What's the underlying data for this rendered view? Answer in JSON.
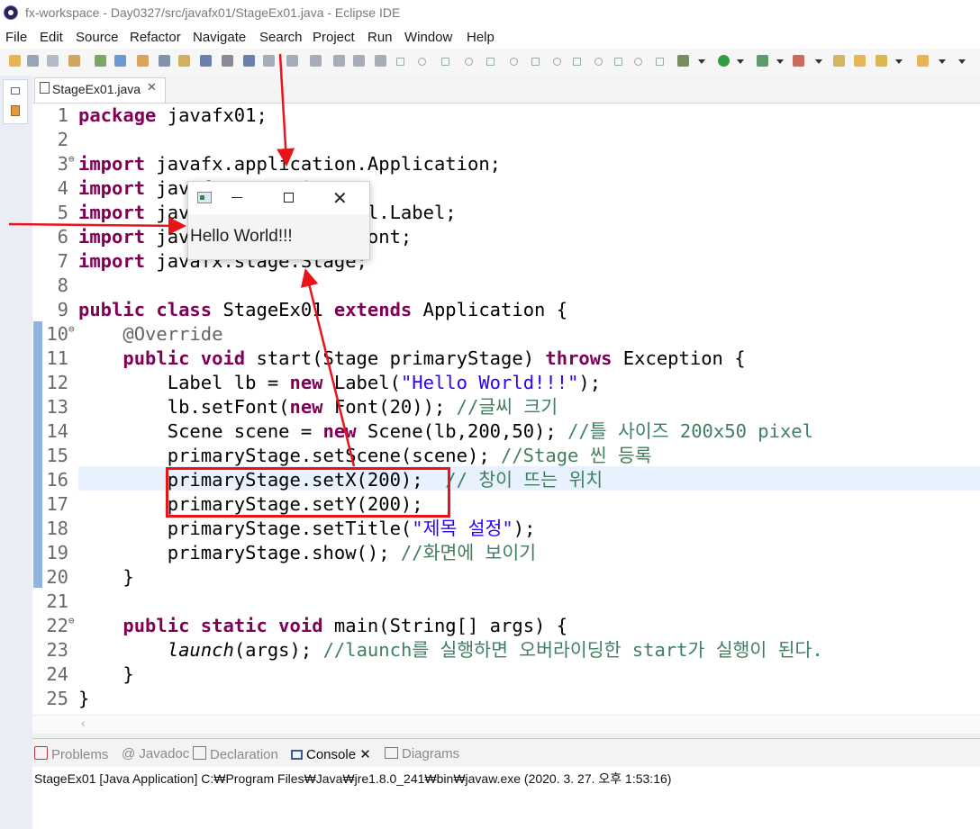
{
  "window": {
    "title": "fx-workspace - Day0327/src/javafx01/StageEx01.java - Eclipse IDE"
  },
  "menu": [
    "File",
    "Edit",
    "Source",
    "Refactor",
    "Navigate",
    "Search",
    "Project",
    "Run",
    "Window",
    "Help"
  ],
  "editor": {
    "tab_label": "StageEx01.java",
    "tab_close": "✕",
    "lines": [
      {
        "n": "1",
        "segs": [
          {
            "c": "kw",
            "t": "package"
          },
          {
            "c": "",
            "t": " javafx01;"
          }
        ]
      },
      {
        "n": "2",
        "segs": []
      },
      {
        "n": "3",
        "fold": "⊖",
        "segs": [
          {
            "c": "kw",
            "t": "import"
          },
          {
            "c": "",
            "t": " javafx.application.Application;"
          }
        ]
      },
      {
        "n": "4",
        "segs": [
          {
            "c": "kw",
            "t": "import"
          },
          {
            "c": "",
            "t": " javafx.scene.Scene;"
          }
        ]
      },
      {
        "n": "5",
        "segs": [
          {
            "c": "kw",
            "t": "import"
          },
          {
            "c": "",
            "t": " javafx.scene.control.Label;"
          }
        ]
      },
      {
        "n": "6",
        "segs": [
          {
            "c": "kw",
            "t": "import"
          },
          {
            "c": "",
            "t": " javafx.scene.text.Font;"
          }
        ]
      },
      {
        "n": "7",
        "segs": [
          {
            "c": "kw",
            "t": "import"
          },
          {
            "c": "",
            "t": " javafx.stage.Stage;"
          }
        ]
      },
      {
        "n": "8",
        "segs": []
      },
      {
        "n": "9",
        "segs": [
          {
            "c": "kw",
            "t": "public class"
          },
          {
            "c": "",
            "t": " StageEx01 "
          },
          {
            "c": "kw",
            "t": "extends"
          },
          {
            "c": "",
            "t": " Application {"
          }
        ]
      },
      {
        "n": "10",
        "fold": "⊖",
        "segs": [
          {
            "c": "ann",
            "t": "    @Override"
          }
        ]
      },
      {
        "n": "11",
        "segs": [
          {
            "c": "",
            "t": "    "
          },
          {
            "c": "kw",
            "t": "public void"
          },
          {
            "c": "",
            "t": " start(Stage primaryStage) "
          },
          {
            "c": "kw",
            "t": "throws"
          },
          {
            "c": "",
            "t": " Exception {"
          }
        ]
      },
      {
        "n": "12",
        "segs": [
          {
            "c": "",
            "t": "        Label lb = "
          },
          {
            "c": "kw",
            "t": "new"
          },
          {
            "c": "",
            "t": " Label("
          },
          {
            "c": "str",
            "t": "\"Hello World!!!\""
          },
          {
            "c": "",
            "t": ");"
          }
        ]
      },
      {
        "n": "13",
        "segs": [
          {
            "c": "",
            "t": "        lb.setFont("
          },
          {
            "c": "kw",
            "t": "new"
          },
          {
            "c": "",
            "t": " Font(20)); "
          },
          {
            "c": "cmt",
            "t": "//글씨 크기"
          }
        ]
      },
      {
        "n": "14",
        "segs": [
          {
            "c": "",
            "t": "        Scene scene = "
          },
          {
            "c": "kw",
            "t": "new"
          },
          {
            "c": "",
            "t": " Scene(lb,200,50); "
          },
          {
            "c": "cmt",
            "t": "//틀 사이즈 200x50 pixel"
          }
        ]
      },
      {
        "n": "15",
        "segs": [
          {
            "c": "",
            "t": "        primaryStage.setScene(scene); "
          },
          {
            "c": "cmt",
            "t": "//Stage 씬 등록"
          }
        ]
      },
      {
        "n": "16",
        "segs": [
          {
            "c": "",
            "t": "        primaryStage.setX(200);  "
          },
          {
            "c": "cmt",
            "t": "// 창이 뜨는 위치"
          }
        ]
      },
      {
        "n": "17",
        "segs": [
          {
            "c": "",
            "t": "        primaryStage.setY(200);"
          }
        ]
      },
      {
        "n": "18",
        "segs": [
          {
            "c": "",
            "t": "        primaryStage.setTitle("
          },
          {
            "c": "str",
            "t": "\"제목 설정\""
          },
          {
            "c": "",
            "t": ");"
          }
        ]
      },
      {
        "n": "19",
        "segs": [
          {
            "c": "",
            "t": "        primaryStage.show(); "
          },
          {
            "c": "cmt",
            "t": "//화면에 보이기"
          }
        ]
      },
      {
        "n": "20",
        "segs": [
          {
            "c": "",
            "t": "    }"
          }
        ]
      },
      {
        "n": "21",
        "segs": []
      },
      {
        "n": "22",
        "fold": "⊖",
        "segs": [
          {
            "c": "",
            "t": "    "
          },
          {
            "c": "kw",
            "t": "public static void"
          },
          {
            "c": "",
            "t": " main(String[] args) {"
          }
        ]
      },
      {
        "n": "23",
        "segs": [
          {
            "c": "",
            "t": "        "
          },
          {
            "c": "it",
            "t": "launch"
          },
          {
            "c": "",
            "t": "(args); "
          },
          {
            "c": "cmt",
            "t": "//launch를 실행하면 오버라이딩한 start가 실행이 된다."
          }
        ]
      },
      {
        "n": "24",
        "segs": [
          {
            "c": "",
            "t": "    }"
          }
        ]
      },
      {
        "n": "25",
        "segs": [
          {
            "c": "",
            "t": "}"
          }
        ]
      }
    ]
  },
  "views": {
    "tabs": [
      {
        "label": "Problems",
        "active": false
      },
      {
        "label": "@ Javadoc",
        "active": false
      },
      {
        "label": "Declaration",
        "active": false
      },
      {
        "label": "Console ✕",
        "active": true
      },
      {
        "label": "Diagrams",
        "active": false
      }
    ],
    "console_status": "StageEx01 [Java Application] C:₩Program Files₩Java₩jre1.8.0_241₩bin₩javaw.exe (2020. 3. 27. 오후 1:53:16)"
  },
  "fx_window": {
    "label": "Hello World!!!",
    "close": "✕"
  },
  "colors": {
    "annotation_red": "#e8141a",
    "keyword": "#7f0055",
    "string": "#2a00ff",
    "comment": "#3f7f5f"
  }
}
